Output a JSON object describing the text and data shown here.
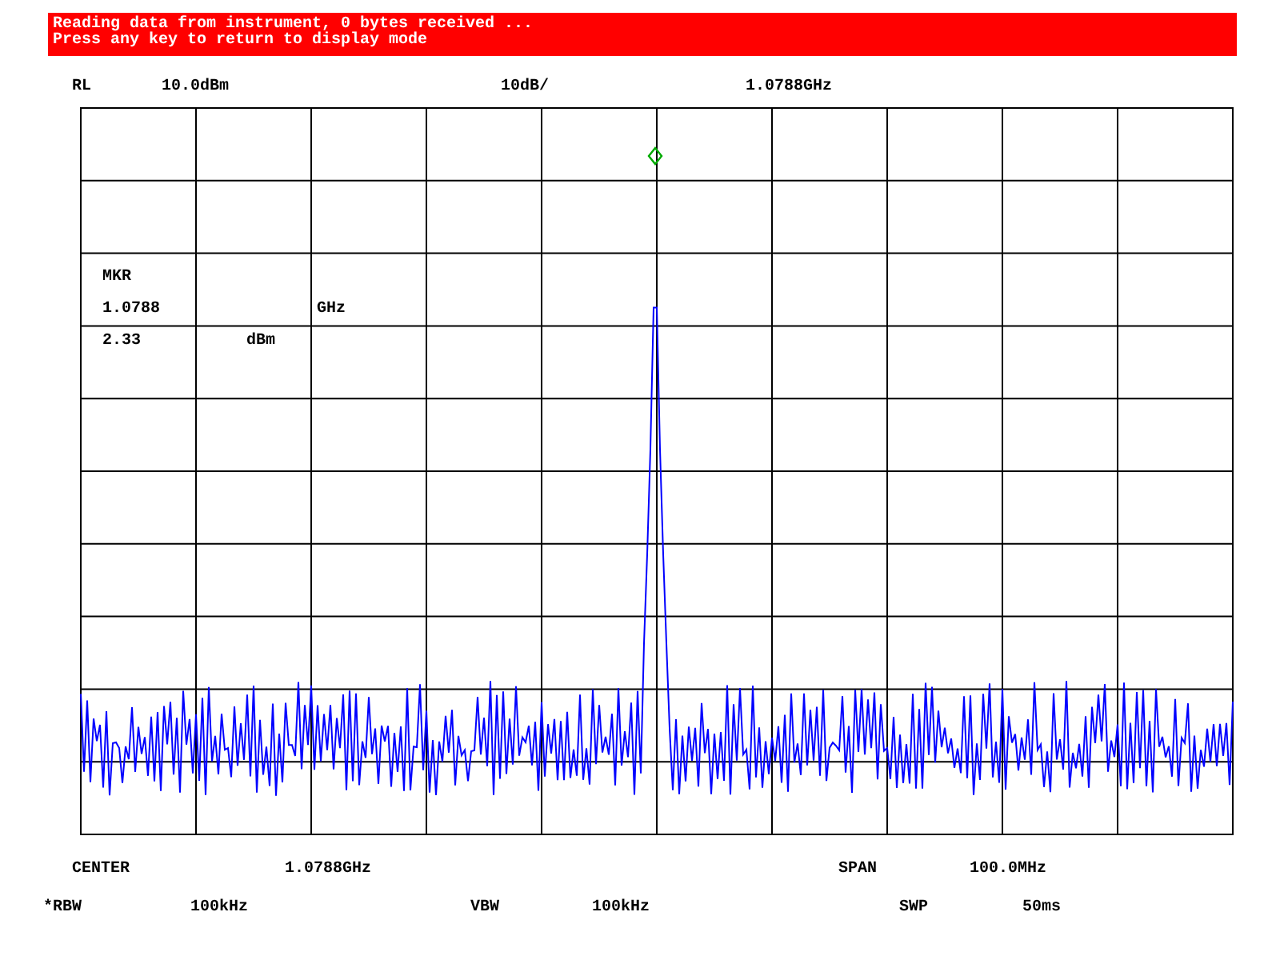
{
  "banner": {
    "lines": [
      "Reading data from instrument, 0 bytes received ...",
      "Press any key to return to display mode"
    ]
  },
  "header": [
    {
      "text": "RL"
    },
    {
      "text": "10.0dBm"
    },
    {
      "text": "10dB/"
    },
    {
      "text": "1.0788GHz"
    }
  ],
  "marker_readout": {
    "label": "MKR",
    "frequency": "1.0788",
    "frequency_unit": "GHz",
    "amplitude": "2.33",
    "amplitude_unit": "dBm"
  },
  "footer_rows": [
    [
      {
        "text": "CENTER"
      },
      {
        "text": "1.0788GHz"
      },
      {
        "text": "SPAN"
      },
      {
        "text": "100.0MHz"
      }
    ],
    [
      {
        "text": "*RBW"
      },
      {
        "text": "100kHz"
      },
      {
        "text": "VBW"
      },
      {
        "text": "100kHz"
      },
      {
        "text": "SWP"
      },
      {
        "text": "50ms"
      }
    ]
  ]
}
